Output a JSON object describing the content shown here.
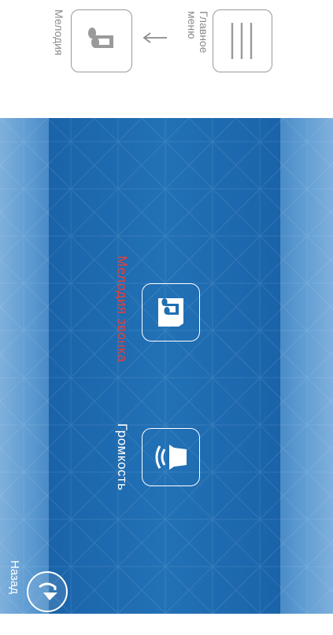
{
  "guide": {
    "main_menu_label": "Главное\nменю",
    "melody_label": "Мелодия",
    "menu_icon": "hamburger-icon",
    "melody_icon": "music-note-icon",
    "arrow_icon": "arrow-left-icon"
  },
  "menu": {
    "items": [
      {
        "label": "Мелодия звонка",
        "icon": "music-note-icon",
        "selected": true
      },
      {
        "label": "Громкость",
        "icon": "speaker-volume-icon",
        "selected": false
      }
    ]
  },
  "back": {
    "label": "Назад",
    "icon": "arrow-back-circle-icon"
  },
  "colors": {
    "screen_background": "#1f6fb3",
    "selected_label": "#e0413c",
    "default_label": "#ffffff",
    "guide_gray": "#8a8a8a"
  }
}
